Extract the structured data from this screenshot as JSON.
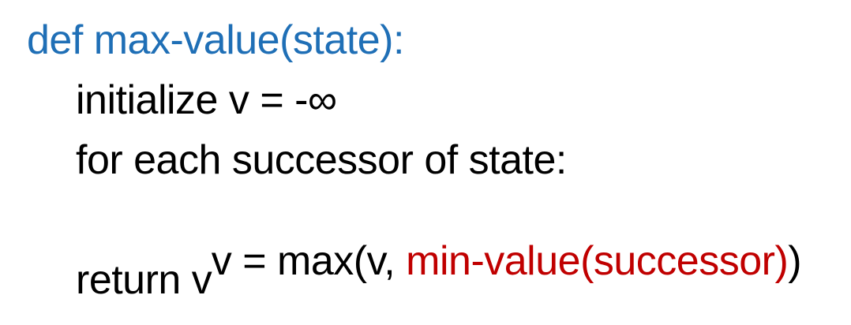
{
  "code": {
    "line1": {
      "text": "def max-value(state):",
      "color": "#1f6fb6"
    },
    "line2": {
      "text": "initialize v = -∞"
    },
    "line3": {
      "text": "for each successor of state:"
    },
    "line4": {
      "prefix": "v = max(v, ",
      "call": "min-value(successor)",
      "suffix": ")",
      "call_color": "#c00000"
    },
    "line5": {
      "text": "return v"
    }
  }
}
